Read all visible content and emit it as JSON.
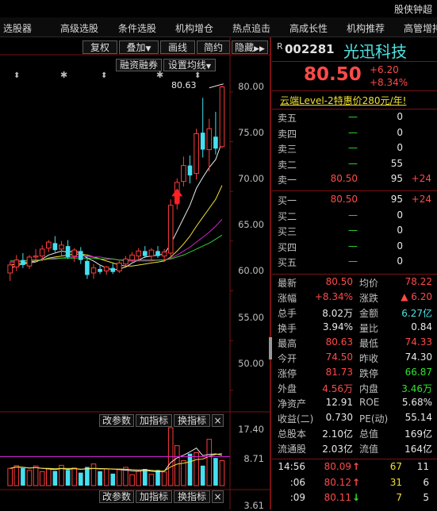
{
  "window": {
    "title": "股侠钟超"
  },
  "menu": {
    "items": [
      "选股器",
      "高级选股",
      "条件选股",
      "机构增仓",
      "热点追击",
      "高成长性",
      "机构推荐",
      "高管增持"
    ]
  },
  "toolbar": {
    "buttons": [
      "复权",
      "叠加",
      "画线",
      "简约",
      "隐藏"
    ],
    "financing_label": "融资融券",
    "ma_setting_label": "设置均线"
  },
  "chart": {
    "max_label": "80.63",
    "y_ticks": [
      "80.00",
      "75.00",
      "70.00",
      "65.00",
      "60.00",
      "55.00",
      "50.00"
    ],
    "vol_ticks": [
      "17.40",
      "8.71"
    ],
    "vol_buttons": [
      "改参数",
      "加指标",
      "换指标"
    ],
    "bottom_buttons": [
      "改参数",
      "加指标",
      "换指标"
    ],
    "bottom_tick": "3.61",
    "close_symbol": "×"
  },
  "chart_data": {
    "type": "candlestick",
    "ylim": [
      48.0,
      81.5
    ],
    "y_ticks": [
      80,
      75,
      70,
      65,
      60,
      55,
      50
    ],
    "candles": [
      {
        "o": 61.8,
        "h": 62.9,
        "l": 61.0,
        "c": 62.6
      },
      {
        "o": 62.4,
        "h": 63.6,
        "l": 62.0,
        "c": 63.1
      },
      {
        "o": 63.1,
        "h": 63.8,
        "l": 62.3,
        "c": 62.6
      },
      {
        "o": 62.5,
        "h": 63.6,
        "l": 62.2,
        "c": 63.4
      },
      {
        "o": 63.4,
        "h": 64.2,
        "l": 62.9,
        "c": 63.5
      },
      {
        "o": 63.5,
        "h": 64.6,
        "l": 63.0,
        "c": 64.2
      },
      {
        "o": 64.3,
        "h": 65.1,
        "l": 63.9,
        "c": 64.9
      },
      {
        "o": 64.8,
        "h": 65.5,
        "l": 63.9,
        "c": 64.1
      },
      {
        "o": 64.2,
        "h": 65.0,
        "l": 63.5,
        "c": 64.6
      },
      {
        "o": 64.5,
        "h": 65.1,
        "l": 63.2,
        "c": 63.4
      },
      {
        "o": 63.5,
        "h": 64.3,
        "l": 62.9,
        "c": 64.1
      },
      {
        "o": 64.0,
        "h": 64.4,
        "l": 62.7,
        "c": 63.1
      },
      {
        "o": 63.0,
        "h": 63.5,
        "l": 61.2,
        "c": 61.6
      },
      {
        "o": 61.8,
        "h": 62.7,
        "l": 61.2,
        "c": 62.3
      },
      {
        "o": 62.2,
        "h": 62.6,
        "l": 61.7,
        "c": 61.9
      },
      {
        "o": 62.0,
        "h": 62.5,
        "l": 61.6,
        "c": 62.4
      },
      {
        "o": 62.3,
        "h": 62.8,
        "l": 61.7,
        "c": 61.9
      },
      {
        "o": 62.0,
        "h": 63.0,
        "l": 61.8,
        "c": 62.8
      },
      {
        "o": 62.7,
        "h": 63.5,
        "l": 62.5,
        "c": 63.2
      },
      {
        "o": 63.1,
        "h": 63.9,
        "l": 62.9,
        "c": 63.6
      },
      {
        "o": 63.5,
        "h": 64.3,
        "l": 63.1,
        "c": 64.0
      },
      {
        "o": 64.0,
        "h": 64.5,
        "l": 63.3,
        "c": 63.5
      },
      {
        "o": 63.5,
        "h": 64.3,
        "l": 63.0,
        "c": 64.1
      },
      {
        "o": 64.0,
        "h": 64.5,
        "l": 63.3,
        "c": 63.5
      },
      {
        "o": 63.5,
        "h": 64.2,
        "l": 62.9,
        "c": 63.9
      },
      {
        "o": 63.8,
        "h": 69.2,
        "l": 63.5,
        "c": 68.6
      },
      {
        "o": 68.9,
        "h": 71.3,
        "l": 68.2,
        "c": 70.9
      },
      {
        "o": 71.0,
        "h": 73.5,
        "l": 70.5,
        "c": 72.6
      },
      {
        "o": 72.6,
        "h": 73.6,
        "l": 70.8,
        "c": 71.6
      },
      {
        "o": 71.8,
        "h": 76.3,
        "l": 71.2,
        "c": 75.8
      },
      {
        "o": 75.9,
        "h": 79.4,
        "l": 73.4,
        "c": 74.2
      },
      {
        "o": 74.2,
        "h": 77.3,
        "l": 72.0,
        "c": 76.3
      },
      {
        "o": 75.5,
        "h": 78.0,
        "l": 73.7,
        "c": 74.3
      },
      {
        "o": 74.5,
        "h": 80.63,
        "l": 74.33,
        "c": 80.5
      }
    ],
    "volumes": [
      5.2,
      6.0,
      5.3,
      4.6,
      5.9,
      4.2,
      5.0,
      4.4,
      6.1,
      4.7,
      5.3,
      3.9,
      5.6,
      6.5,
      4.3,
      5.0,
      3.6,
      4.8,
      5.5,
      3.3,
      4.4,
      5.0,
      3.4,
      4.7,
      4.1,
      17.4,
      12.0,
      7.5,
      9.6,
      9.9,
      6.0,
      13.9,
      8.3,
      7.5
    ],
    "ma": [
      {
        "color": "#e8e8e8",
        "values": [
          62.3,
          62.5,
          62.7,
          62.8,
          62.9,
          63.2,
          63.6,
          63.8,
          64.0,
          63.9,
          64.0,
          63.8,
          63.3,
          63.0,
          62.6,
          62.3,
          62.1,
          62.2,
          62.4,
          62.8,
          63.1,
          63.4,
          63.5,
          63.6,
          63.7,
          64.7,
          66.0,
          67.3,
          68.6,
          70.3,
          71.4,
          72.4,
          73.2,
          75.0
        ]
      },
      {
        "color": "#f0e030",
        "values": [
          62.6,
          62.7,
          62.8,
          62.9,
          63.0,
          63.1,
          63.3,
          63.4,
          63.5,
          63.6,
          63.7,
          63.7,
          63.6,
          63.4,
          63.2,
          63.0,
          62.8,
          62.6,
          62.5,
          62.5,
          62.6,
          62.7,
          62.8,
          62.9,
          63.0,
          63.4,
          64.0,
          64.7,
          65.5,
          66.5,
          67.4,
          68.3,
          69.2,
          70.6
        ]
      },
      {
        "color": "#d020d0",
        "values": [
          62.9,
          62.9,
          63.0,
          63.0,
          63.1,
          63.1,
          63.2,
          63.3,
          63.3,
          63.4,
          63.4,
          63.5,
          63.5,
          63.4,
          63.4,
          63.3,
          63.2,
          63.1,
          63.0,
          63.0,
          63.0,
          63.0,
          63.0,
          63.1,
          63.1,
          63.3,
          63.6,
          64.0,
          64.4,
          64.9,
          65.4,
          65.9,
          66.5,
          67.2
        ]
      },
      {
        "color": "#30d030",
        "values": [
          63.0,
          63.0,
          63.0,
          63.1,
          63.1,
          63.1,
          63.2,
          63.2,
          63.3,
          63.3,
          63.3,
          63.3,
          63.3,
          63.3,
          63.2,
          63.2,
          63.2,
          63.1,
          63.1,
          63.1,
          63.1,
          63.1,
          63.1,
          63.1,
          63.1,
          63.2,
          63.4,
          63.6,
          63.9,
          64.2,
          64.5,
          64.8,
          65.2,
          65.6
        ]
      }
    ]
  },
  "quote": {
    "code_prefix": "R",
    "code": "002281",
    "name": "光迅科技",
    "price": "80.50",
    "change": "+6.20",
    "change_pct": "+8.34%",
    "promo": "云端Level-2特惠价280元/年!",
    "asks": [
      {
        "label": "卖五",
        "price": "—",
        "vol": "0",
        "chg": ""
      },
      {
        "label": "卖四",
        "price": "—",
        "vol": "0",
        "chg": ""
      },
      {
        "label": "卖三",
        "price": "—",
        "vol": "0",
        "chg": ""
      },
      {
        "label": "卖二",
        "price": "—",
        "vol": "55",
        "chg": ""
      },
      {
        "label": "卖一",
        "price": "80.50",
        "vol": "95",
        "chg": "+24"
      }
    ],
    "bids": [
      {
        "label": "买一",
        "price": "80.50",
        "vol": "95",
        "chg": "+24"
      },
      {
        "label": "买二",
        "price": "—",
        "vol": "0",
        "chg": ""
      },
      {
        "label": "买三",
        "price": "—",
        "vol": "0",
        "chg": ""
      },
      {
        "label": "买四",
        "price": "—",
        "vol": "0",
        "chg": ""
      },
      {
        "label": "买五",
        "price": "—",
        "vol": "0",
        "chg": ""
      }
    ],
    "stats": [
      {
        "l1": "最新",
        "v1": "80.50",
        "c1": "red",
        "l2": "均价",
        "v2": "78.22",
        "c2": "red"
      },
      {
        "l1": "涨幅",
        "v1": "+8.34%",
        "c1": "red",
        "l2": "涨跌",
        "v2": "▲ 6.20",
        "c2": "red"
      },
      {
        "l1": "总手",
        "v1": "8.02万",
        "c1": "white",
        "l2": "金额",
        "v2": "6.27亿",
        "c2": "cyan"
      },
      {
        "l1": "换手",
        "v1": "3.94%",
        "c1": "white",
        "l2": "量比",
        "v2": "0.84",
        "c2": "white"
      },
      {
        "l1": "最高",
        "v1": "80.63",
        "c1": "red",
        "l2": "最低",
        "v2": "74.33",
        "c2": "red"
      },
      {
        "l1": "今开",
        "v1": "74.50",
        "c1": "red",
        "l2": "昨收",
        "v2": "74.30",
        "c2": "white"
      },
      {
        "l1": "涨停",
        "v1": "81.73",
        "c1": "red",
        "l2": "跌停",
        "v2": "66.87",
        "c2": "green"
      },
      {
        "l1": "外盘",
        "v1": "4.56万",
        "c1": "red",
        "l2": "内盘",
        "v2": "3.46万",
        "c2": "green"
      },
      {
        "l1": "净资产",
        "v1": "12.91",
        "c1": "white",
        "l2": "ROE",
        "v2": "5.68%",
        "c2": "white"
      },
      {
        "l1": "收益(二)",
        "v1": "0.730",
        "c1": "white",
        "l2": "PE(动)",
        "v2": "55.14",
        "c2": "white"
      },
      {
        "l1": "总股本",
        "v1": "2.10亿",
        "c1": "white",
        "l2": "总值",
        "v2": "169亿",
        "c2": "white"
      },
      {
        "l1": "流通股",
        "v1": "2.03亿",
        "c1": "white",
        "l2": "流值",
        "v2": "164亿",
        "c2": "white"
      }
    ],
    "ticks": [
      {
        "time": "14:56",
        "price": "80.09",
        "arrow": "↑",
        "arrow_color": "red",
        "vol": "67",
        "n": "11"
      },
      {
        "time": ":06",
        "price": "80.12",
        "arrow": "↑",
        "arrow_color": "red",
        "vol": "31",
        "n": "6"
      },
      {
        "time": ":09",
        "price": "80.11",
        "arrow": "↓",
        "arrow_color": "green",
        "vol": "7",
        "n": "5"
      }
    ]
  }
}
